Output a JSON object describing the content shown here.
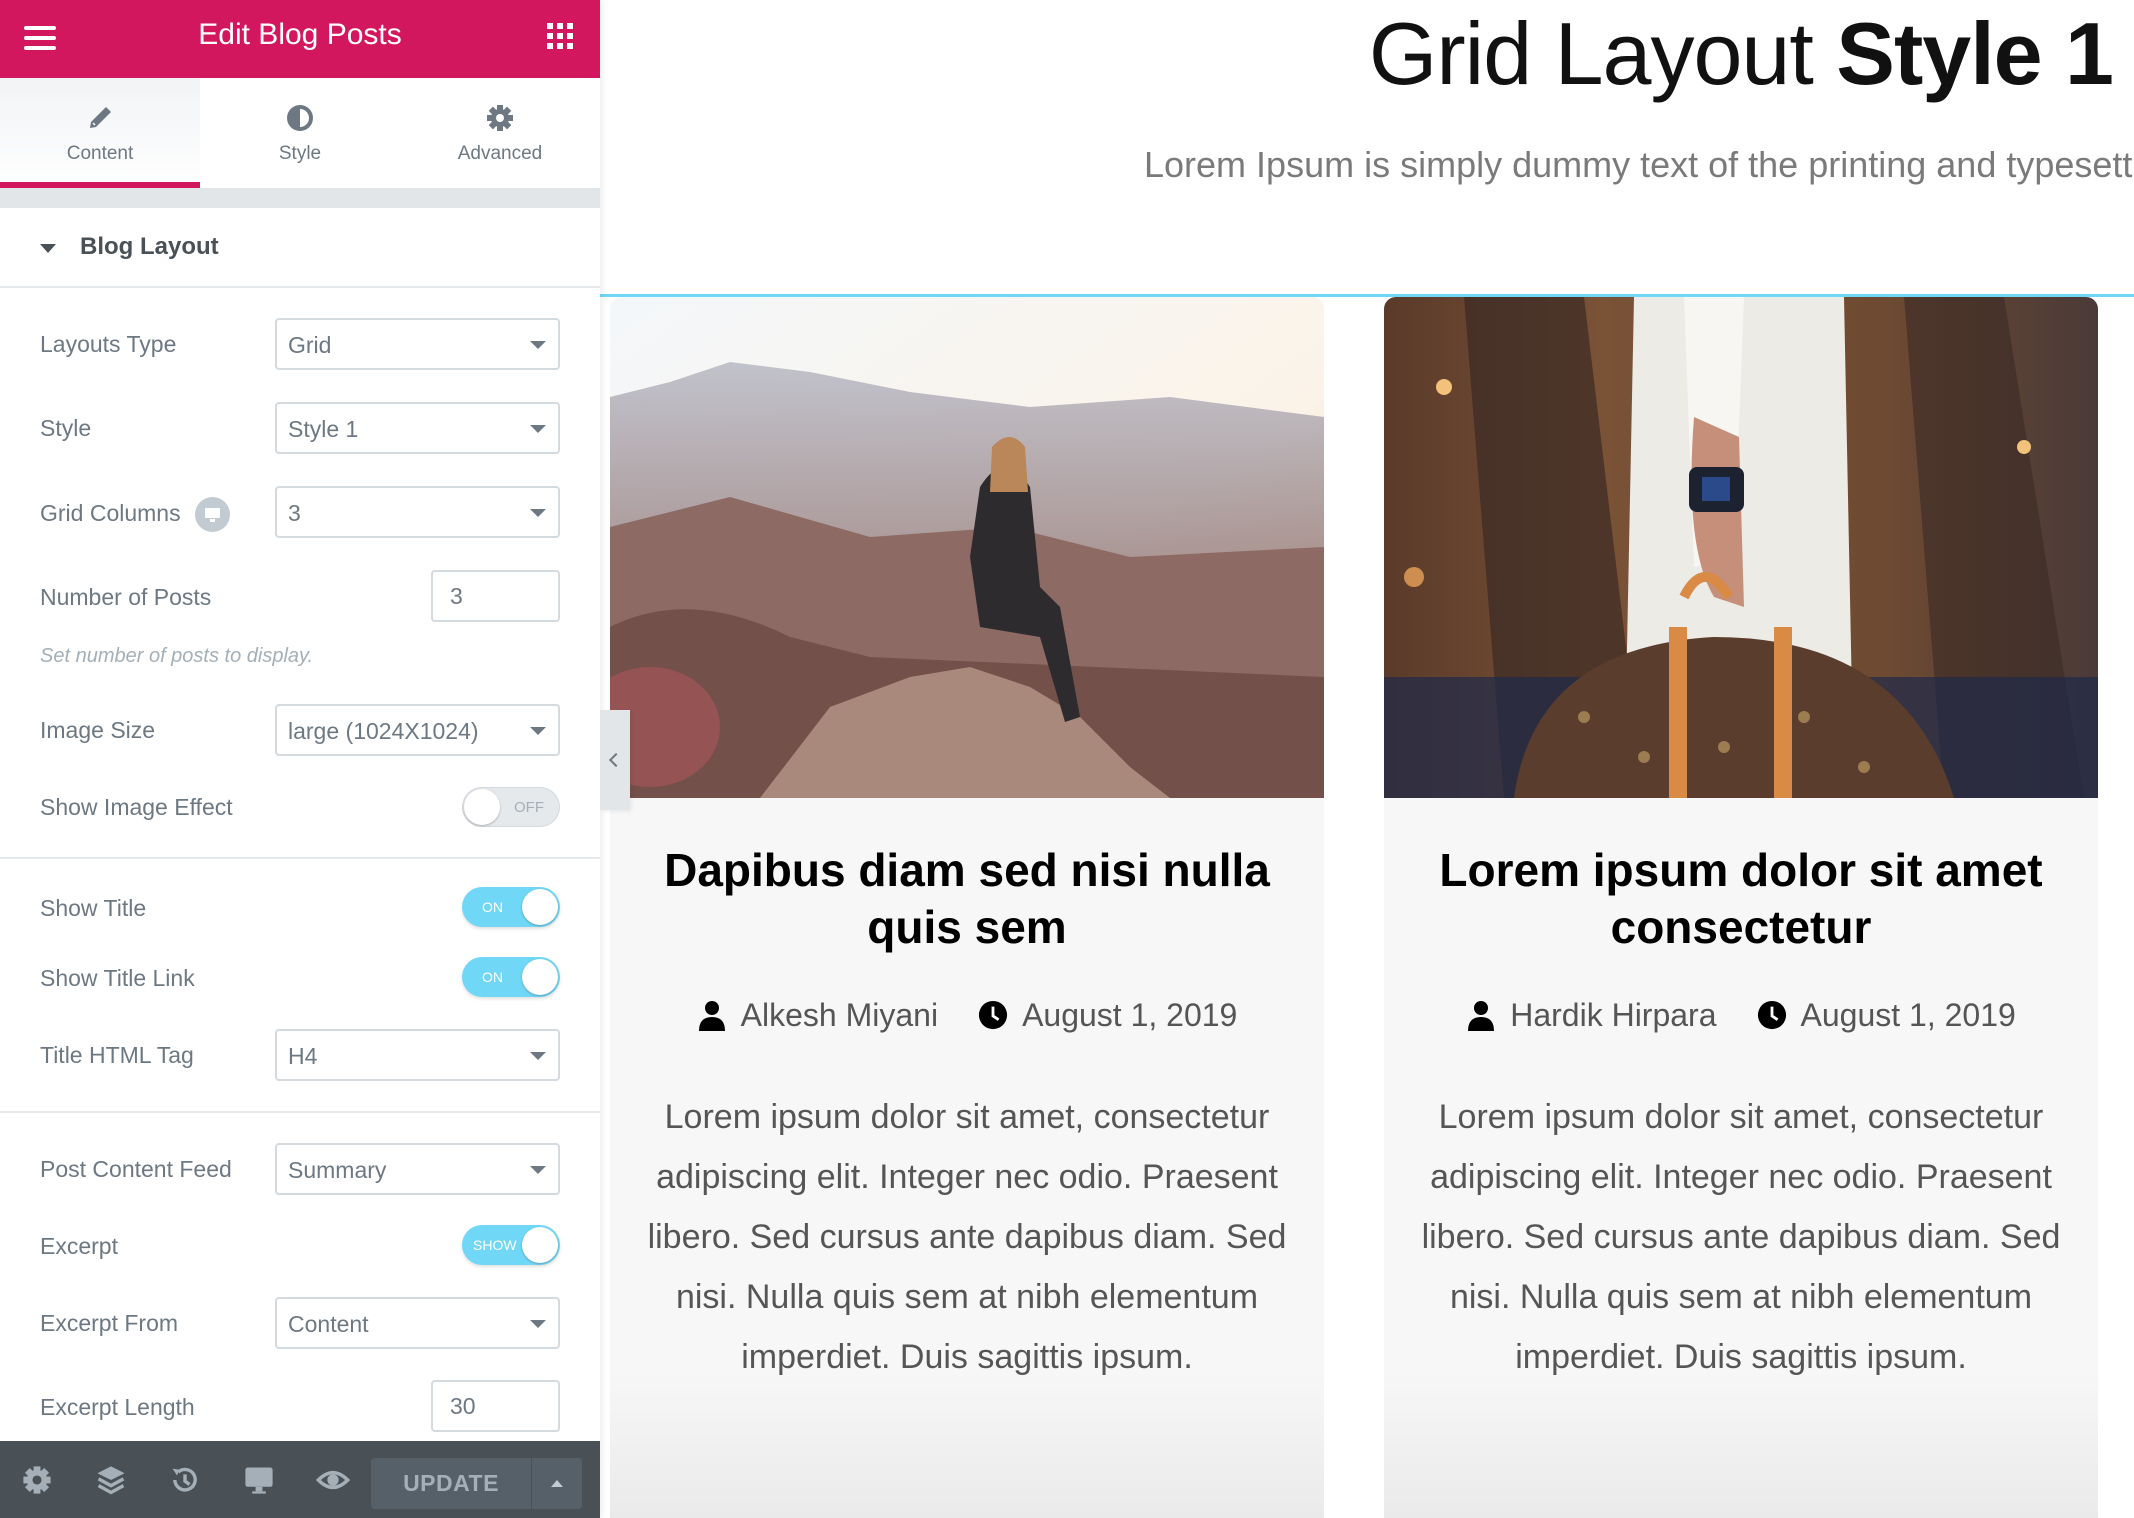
{
  "panel": {
    "title": "Edit Blog Posts",
    "tabs": [
      {
        "label": "Content",
        "icon": "pencil-icon",
        "active": true
      },
      {
        "label": "Style",
        "icon": "half-circle-icon",
        "active": false
      },
      {
        "label": "Advanced",
        "icon": "gear-icon",
        "active": false
      }
    ],
    "section_title": "Blog Layout",
    "controls": {
      "layouts_type": {
        "label": "Layouts Type",
        "value": "Grid"
      },
      "style": {
        "label": "Style",
        "value": "Style 1"
      },
      "grid_columns": {
        "label": "Grid Columns",
        "value": "3"
      },
      "number_of_posts": {
        "label": "Number of Posts",
        "value": "3",
        "description": "Set number of posts to display."
      },
      "image_size": {
        "label": "Image Size",
        "value": "large (1024X1024)"
      },
      "show_image_effect": {
        "label": "Show Image Effect",
        "state": "OFF"
      },
      "show_title": {
        "label": "Show Title",
        "state": "ON"
      },
      "show_title_link": {
        "label": "Show Title Link",
        "state": "ON"
      },
      "title_html_tag": {
        "label": "Title HTML Tag",
        "value": "H4"
      },
      "post_content_feed": {
        "label": "Post Content Feed",
        "value": "Summary"
      },
      "excerpt": {
        "label": "Excerpt",
        "state": "SHOW"
      },
      "excerpt_from": {
        "label": "Excerpt From",
        "value": "Content"
      },
      "excerpt_length": {
        "label": "Excerpt Length",
        "value": "30"
      }
    },
    "footer": {
      "icons": [
        "gear-icon",
        "layers-icon",
        "history-icon",
        "desktop-icon",
        "eye-icon"
      ],
      "update_label": "UPDATE"
    }
  },
  "preview": {
    "title_regular": "Grid Layout ",
    "title_bold": "Style 1",
    "subtitle": "Lorem Ipsum is simply dummy text of the printing and typesetting",
    "posts": [
      {
        "title": "Dapibus diam sed nisi nulla quis sem",
        "author": "Alkesh Miyani",
        "date": "August 1, 2019",
        "excerpt": "Lorem ipsum dolor sit amet, consectetur adipiscing elit. Integer nec odio. Praesent libero. Sed cursus ante dapibus diam. Sed nisi. Nulla quis sem at nibh elementum imperdiet. Duis sagittis ipsum.",
        "image": "woman-sitting-on-mountain-rock"
      },
      {
        "title": "Lorem ipsum dolor sit amet consectetur",
        "author": "Hardik Hirpara",
        "date": "August 1, 2019",
        "excerpt": "Lorem ipsum dolor sit amet, consectetur adipiscing elit. Integer nec odio. Praesent libero. Sed cursus ante dapibus diam. Sed nisi. Nulla quis sem at nibh elementum imperdiet. Duis sagittis ipsum.",
        "image": "hand-holding-luggage-bag"
      }
    ]
  },
  "colors": {
    "brand": "#d2175e",
    "toggle_on": "#71d7f7",
    "section_line": "#71d7f7",
    "footer_bg": "#495157"
  }
}
